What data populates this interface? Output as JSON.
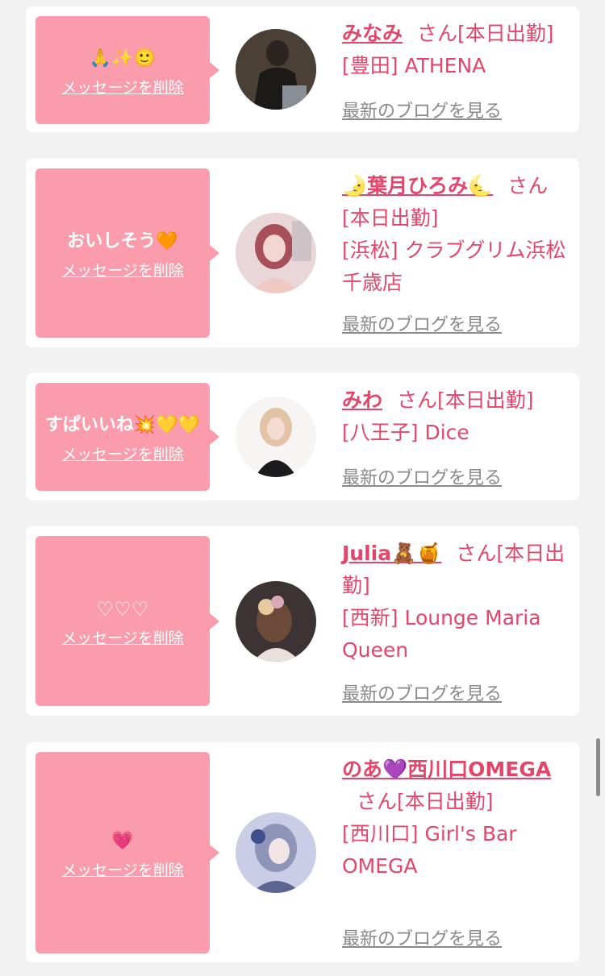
{
  "cards": [
    {
      "message": "🙏✨🙂",
      "delete_label": "メッセージを削除",
      "name": "みなみ",
      "honorific": "さん",
      "status": "[本日出勤]",
      "shop": "[豊田] ATHENA",
      "blog_label": "最新のブログを見る"
    },
    {
      "message": "おいしそう🧡",
      "delete_label": "メッセージを削除",
      "name": "🌛葉月ひろみ🌜",
      "honorific": "さん",
      "status": "[本日出勤]",
      "shop": "[浜松] クラブグリム浜松千歳店",
      "blog_label": "最新のブログを見る"
    },
    {
      "message": "すぱいいね💥💛💛",
      "delete_label": "メッセージを削除",
      "name": "みわ",
      "honorific": "さん",
      "status": "[本日出勤]",
      "shop": "[八王子] Dice",
      "blog_label": "最新のブログを見る"
    },
    {
      "message": "♡♡♡",
      "delete_label": "メッセージを削除",
      "name": "Julia🧸🍯",
      "honorific": "さん",
      "status": "[本日出勤]",
      "shop": "[西新] Lounge Maria Queen",
      "blog_label": "最新のブログを見る"
    },
    {
      "message": "💗",
      "delete_label": "メッセージを削除",
      "name": "のあ💜西川口OMEGA",
      "honorific": "さん",
      "status": "[本日出勤]",
      "shop": "[西川口] Girl's Bar OMEGA",
      "blog_label": "最新のブログを見る"
    }
  ],
  "colors": {
    "accent": "#e4466b",
    "bubble": "#fb9cad",
    "background": "#f2f2f2",
    "muted_link": "#8a8a8a"
  }
}
